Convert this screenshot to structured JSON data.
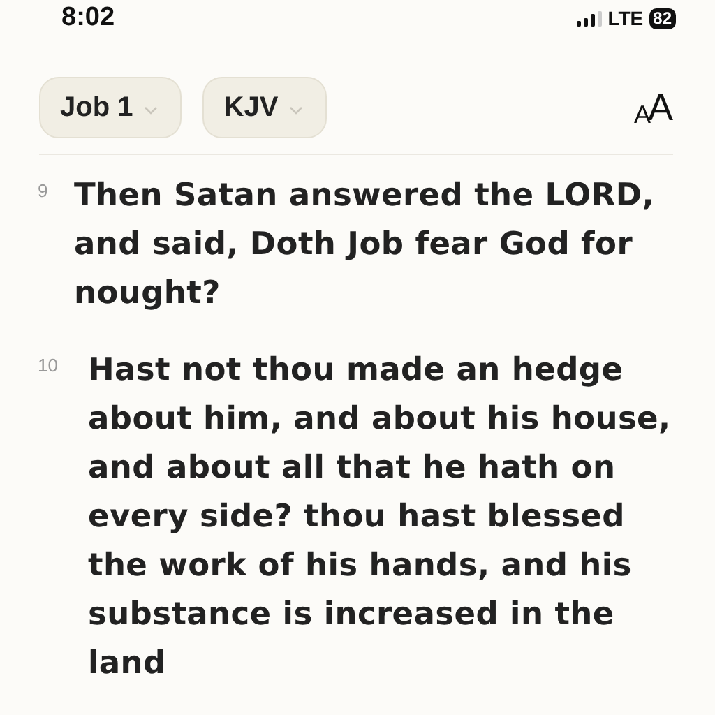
{
  "status_bar": {
    "time": "8:02",
    "network": "LTE",
    "battery": "82"
  },
  "toolbar": {
    "book_chapter": "Job 1",
    "version": "KJV",
    "text_size": {
      "small": "A",
      "large": "A"
    }
  },
  "verses": [
    {
      "number": "9",
      "text": "Then Satan answered the LORD, and said, Doth Job fear God for nought?"
    },
    {
      "number": "10",
      "text": "Hast not thou made an hedge about him, and about his house, and about all that he hath on every side? thou hast blessed the work of his hands, and his substance is increased in the land"
    }
  ]
}
